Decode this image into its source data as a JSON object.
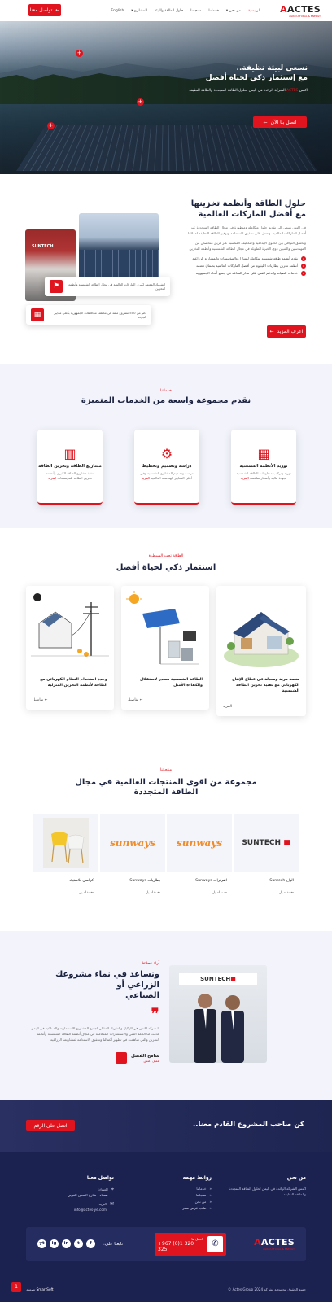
{
  "header": {
    "logo": {
      "text": "ACTES",
      "tagline": "AGRICULTURAL & ENERGY"
    },
    "nav": [
      {
        "label": "الرئيسية",
        "active": true
      },
      {
        "label": "من نحن ▾",
        "active": false
      },
      {
        "label": "خدماتنا",
        "active": false
      },
      {
        "label": "منتجاتنا",
        "active": false
      },
      {
        "label": "حلول الطاقة والبيئة",
        "active": false
      },
      {
        "label": "المشاريع ▾",
        "active": false
      },
      {
        "label": "English",
        "active": false
      }
    ],
    "cta": "تواصل معنا"
  },
  "hero": {
    "title_line1": "نسعى لبيئة نظيفة..",
    "title_line2": "مع إستثمار ذكي لحياة أفضل",
    "subtitle_prefix": "اكتس",
    "subtitle_brand": "ACTES",
    "subtitle": "الشركة الرائدة في اليمن لحلول الطاقة المتجددة والطاقة النظيفة",
    "button": "اتصل بنا الآن"
  },
  "solutions": {
    "title_line1": "حلول الطاقة وأنظمة تخزينها",
    "title_line2": "مع أفضل الماركات العالمية",
    "p1": "في اكتس نسعى إلى تقديم حلول متكاملة ومتطورة في مجال الطاقة المتجددة عبر أفضل الماركات العالمية، ونعمل على تحقيق الاستدامة وتوفير الطاقة النظيفة لعملائنا",
    "p2": "وتحقيق التوافق بين الحلول الإبداعية والتكاليف المناسبة عبر فريق متخصص من المهندسين والفنيين ذوي الخبرة الطويلة في مجال الطاقة الشمسية وأنظمة التخزين",
    "checks": [
      "نقدم أنظمة طاقة شمسية متكاملة للمنازل والمؤسسات والمشاريع الزراعية",
      "أنظمة تخزين بطاريات الليثيوم من أفضل الماركات العالمية بضمان معتمد",
      "خدمات الصيانة والدعم الفني على مدار الساعة في جميع أنحاء الجمهورية"
    ],
    "button": "اعرف المزيد",
    "float1": "الشريك المعتمد لكبرى الماركات العالمية في مجال الطاقة الشمسية وأنظمة التخزين",
    "float2": "أكثر من 500 مشروع منفذ في مختلف محافظات الجمهورية بأعلى معايير الجودة"
  },
  "services": {
    "eyebrow": "خدماتنا",
    "title": "نقدم مجموعة واسعة من الخدمات المتميزة",
    "items": [
      {
        "title": "توريد الأنظمة الشمسية",
        "desc": "توريد وتركيب منظومات الطاقة الشمسية بجودة عالية وأسعار منافسة",
        "link": "المزيد"
      },
      {
        "title": "دراسة وتصميم وتخطيط",
        "desc": "دراسة وتصميم المشاريع الشمسية وفق أعلى المعايير الهندسية العالمية",
        "link": "المزيد"
      },
      {
        "title": "مشاريع الطاقة وتخزين الطاقة",
        "desc": "تنفيذ مشاريع الطاقة الكبرى وأنظمة تخزين الطاقة للمؤسسات",
        "link": "المزيد"
      }
    ]
  },
  "investment": {
    "eyebrow": "الطاقة تحت السيطرة",
    "title": "استثمار ذكي لحياة أفضل",
    "cards": [
      {
        "title": "منصة مرنة ومعدلة في قطاع الإنتاج الكهربائي مع تقنية تخزين الطاقة الشمسية",
        "more": "المزيد"
      },
      {
        "title": "الطاقة الشمسية مصدر لاستقلال والكفاءة الأمثل",
        "more": "تفاصيل"
      },
      {
        "title": "وحدة استخدام النظام الكهربائي مع الطاقة لأنظمة التخزين المنزلية",
        "more": "تفاصيل"
      }
    ]
  },
  "products": {
    "eyebrow": "منتجاتنا",
    "title_line1": "مجموعة من اقوى المنتجات العالمية في مجال",
    "title_line2": "الطاقة المتجددة",
    "items": [
      {
        "brand": "SUNTECH",
        "caption": "الواح Suntech",
        "more": "تفاصيل"
      },
      {
        "brand": "sunways",
        "caption": "انفرترات Sunways",
        "more": "تفاصيل"
      },
      {
        "brand": "sunways",
        "caption": "بطاريات Sunways",
        "more": "تفاصيل"
      },
      {
        "brand": "",
        "caption": "كراسي بلاستيك",
        "more": "تفاصيل"
      }
    ]
  },
  "testimonial": {
    "eyebrow": "آراء عملائنا",
    "title_line1": "ونساعد في نماء مشروعك الزراعي أو",
    "title_line2": "الصناعي",
    "quote": "يا شركة اكتس هي الوكيل والشريك المثالي لجميع المشاريع الاستثمارية والصناعية في اليمن، قدمت لنا الدعم الفني والاستشارات المتكاملة في مجال أنظمة الطاقة الشمسية وأنظمة التخزين والتي ساهمت في تطوير أعمالنا وتحقيق الاستدامة لمشاريعنا الزراعية",
    "name": "سامح الفضل",
    "role": "عميل اكتس",
    "brand": "SUNTECH"
  },
  "cta": {
    "text": "كن صاحب المشروع القادم معنا..",
    "button": "اتصل على الرقم"
  },
  "footer": {
    "about_title": "من نحن",
    "about_text": "اكتس الشركة الرائدة في اليمن لحلول الطاقة المتجددة والطاقة النظيفة",
    "links_title": "روابط مهمة",
    "links": [
      "خدماتنا",
      "منتجاتنا",
      "من نحن",
      "طلب عرض سعر"
    ],
    "contact_title": "تواصل معنا",
    "contact_address_label": "العنوان",
    "contact_address": "صنعاء - شارع الستين الغربي",
    "contact_email_label": "البريد",
    "contact_email": "info@actes-ye.com",
    "phone_label": "اتصل بنا",
    "phone": "+967 (0)1 320 325",
    "follow": "تابعنا على:",
    "social": [
      "f",
      "t",
      "in",
      "ig",
      "yt"
    ],
    "copyright": "جميع الحقوق محفوظة لشركة Actes Group 2024 ©",
    "credit": "SmartSoft",
    "credit_suffix": "تصميم",
    "badge": "1"
  },
  "colors": {
    "accent": "#e0141e",
    "navy": "#1c2250",
    "light": "#f2f3fb"
  }
}
